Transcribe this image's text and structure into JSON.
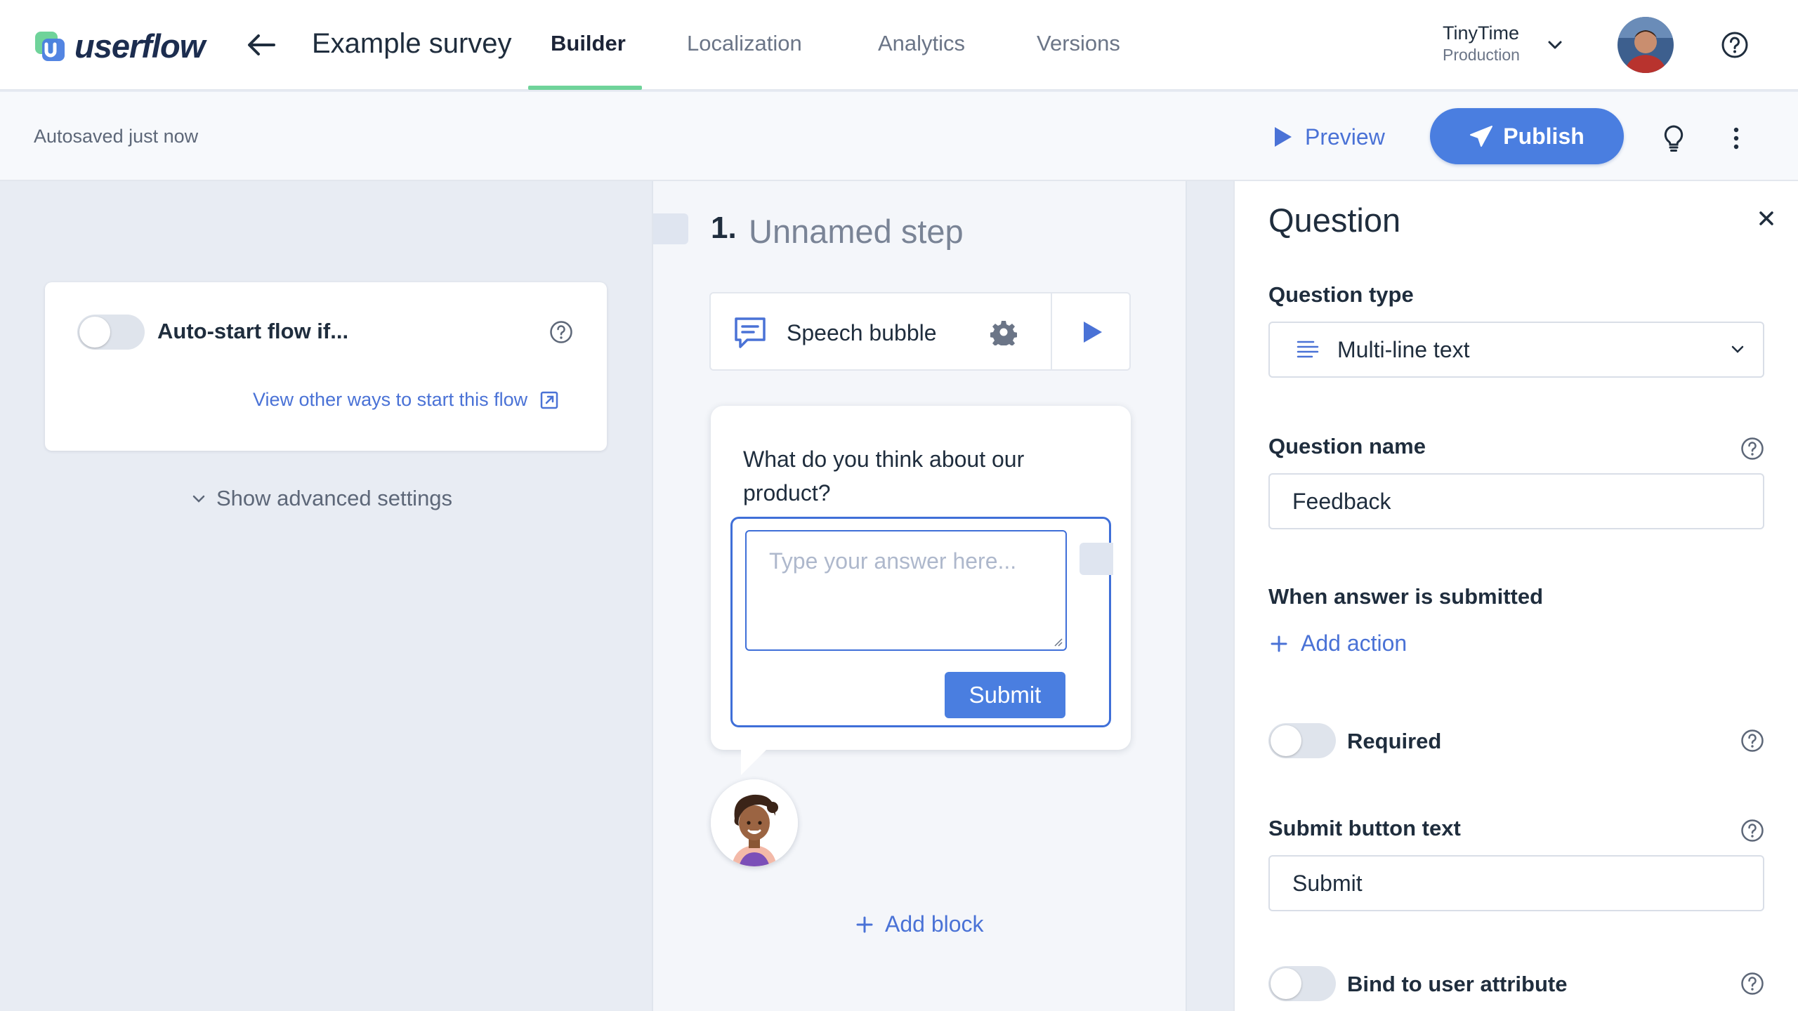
{
  "header": {
    "logo_text": "userflow",
    "survey_title": "Example survey",
    "tabs": [
      {
        "label": "Builder",
        "active": true
      },
      {
        "label": "Localization",
        "active": false
      },
      {
        "label": "Analytics",
        "active": false
      },
      {
        "label": "Versions",
        "active": false
      }
    ],
    "org": {
      "name": "TinyTime",
      "environment": "Production"
    }
  },
  "subbar": {
    "autosave_status": "Autosaved just now",
    "preview_label": "Preview",
    "publish_label": "Publish"
  },
  "left": {
    "auto_start_label": "Auto-start flow if...",
    "auto_start_enabled": false,
    "view_other_ways_link": "View other ways to start this flow",
    "advanced_settings_label": "Show advanced settings"
  },
  "step": {
    "number": "1.",
    "name": "Unnamed step",
    "block_type": "Speech bubble",
    "question_text": "What do you think about our product?",
    "answer_placeholder": "Type your answer here...",
    "submit_label": "Submit",
    "add_block_label": "Add block"
  },
  "panel": {
    "title": "Question",
    "question_type_label": "Question type",
    "question_type_value": "Multi-line text",
    "question_name_label": "Question name",
    "question_name_value": "Feedback",
    "on_submit_label": "When answer is submitted",
    "add_action_label": "Add action",
    "required_label": "Required",
    "required_enabled": false,
    "submit_text_label": "Submit button text",
    "submit_text_value": "Submit",
    "bind_attribute_label": "Bind to user attribute",
    "bind_attribute_enabled": false
  },
  "colors": {
    "accent": "#4a7ee0",
    "link": "#4a72d6",
    "active_tab_underline": "#6fd39a",
    "canvas_background": "#e8ecf3"
  }
}
